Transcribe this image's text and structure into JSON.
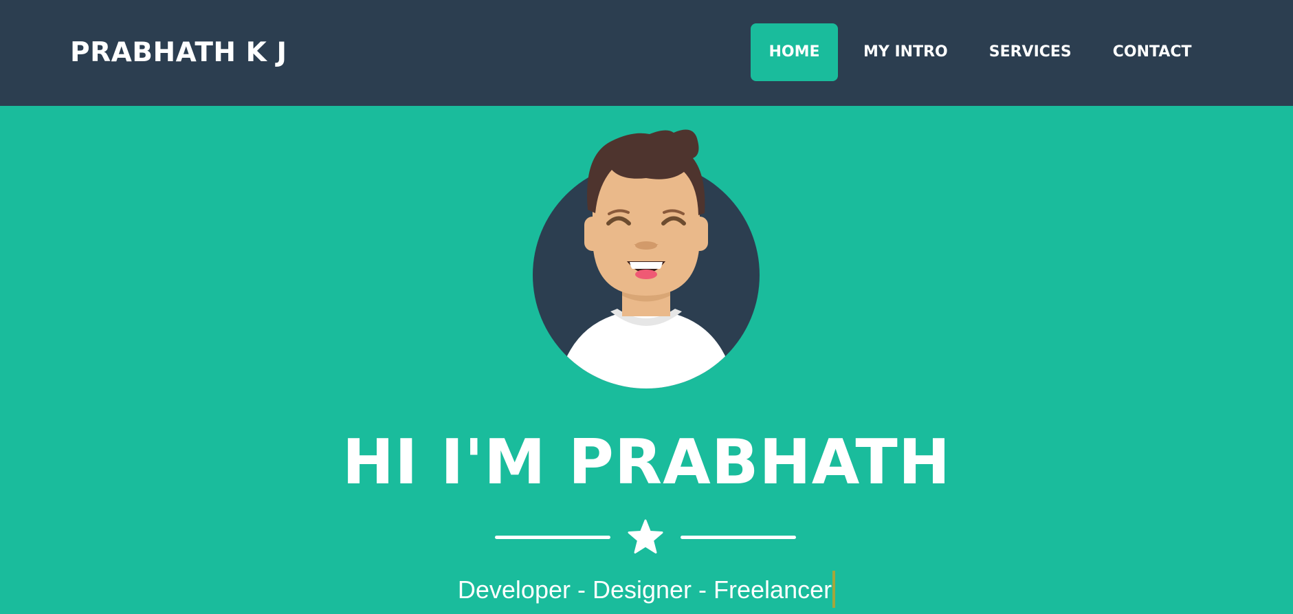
{
  "header": {
    "brand": "PRABHATH K J",
    "nav": [
      {
        "label": "HOME",
        "active": true
      },
      {
        "label": "MY INTRO",
        "active": false
      },
      {
        "label": "SERVICES",
        "active": false
      },
      {
        "label": "CONTACT",
        "active": false
      }
    ]
  },
  "hero": {
    "avatar_icon": "smiling-man-avatar",
    "headline": "HI I'M PRABHATH",
    "divider_icon": "star-icon",
    "tagline": "Developer - Designer - Freelancer"
  },
  "colors": {
    "navbar": "#2c3e50",
    "accent": "#1abc9c",
    "text": "#ffffff",
    "cursor": "#a5a63a"
  }
}
